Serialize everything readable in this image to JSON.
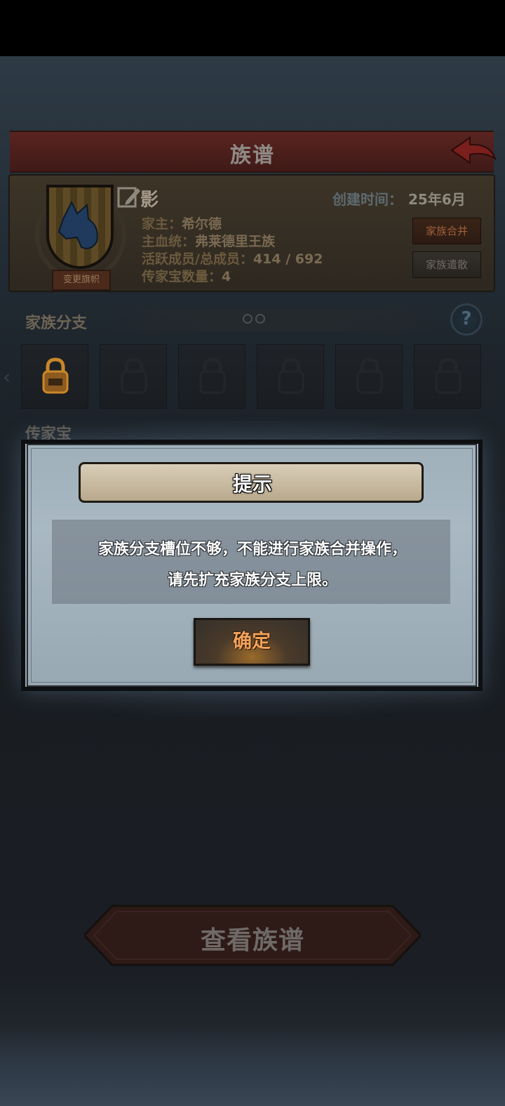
{
  "header": {
    "title": "族谱",
    "back_icon": "back-arrow-icon"
  },
  "clan": {
    "name": "影",
    "created_label": "创建时间：",
    "created_value": "25年6月",
    "leader_label": "家主：",
    "leader_value": "希尔德",
    "bloodline_label": "主血统：",
    "bloodline_value": "弗莱德里王族",
    "members_label": "活跃成员/总成员：",
    "members_value": "414 / 692",
    "heirloom_label": "传家宝数量：",
    "heirloom_value": "4",
    "change_banner_label": "变更旗帜",
    "merge_label": "家族合并",
    "disband_label": "家族遣散",
    "crest_icon": "wolf-crest-icon"
  },
  "branches": {
    "title": "家族分支",
    "help_label": "?",
    "slot_count": 6,
    "unlocked_slots": 1
  },
  "heirloom_section": {
    "title": "传家宝"
  },
  "dialog": {
    "title": "提示",
    "message_line1": "家族分支槽位不够，不能进行家族合并操作，",
    "message_line2": "请先扩充家族分支上限。",
    "ok_label": "确定"
  },
  "footer": {
    "view_tree_label": "查看族谱"
  },
  "colors": {
    "banner_red": "#5a2420",
    "dialog_bg": "#a9b8c2",
    "ok_text": "#f2a25a",
    "lock_gold": "#c9872a"
  }
}
